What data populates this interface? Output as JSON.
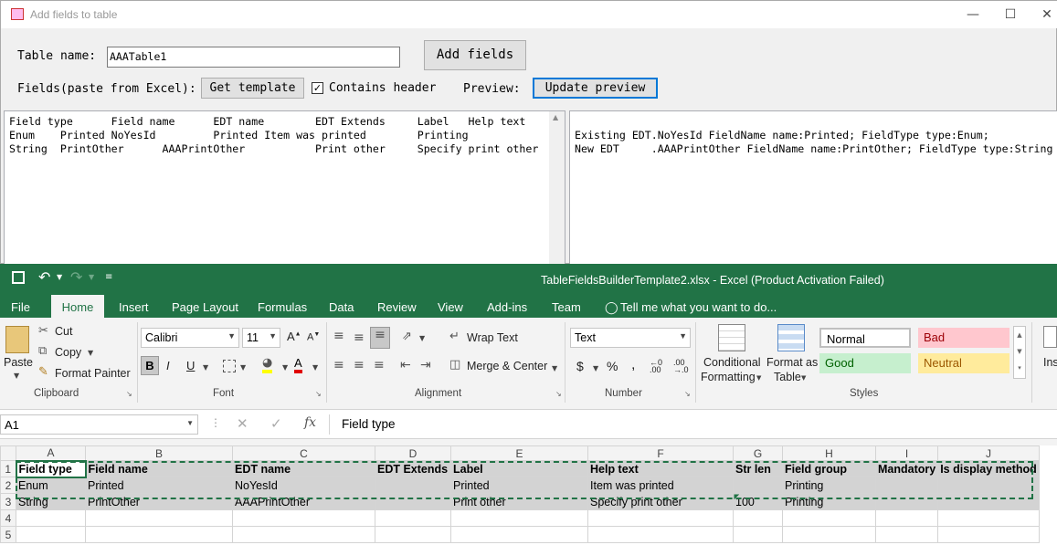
{
  "dialog": {
    "title": "Add fields to table",
    "table_name_label": "Table name:",
    "table_name_value": "AAATable1",
    "add_fields_label": "Add fields",
    "fields_label": "Fields(paste from Excel):",
    "get_template_label": "Get template",
    "contains_header_label": "Contains header",
    "contains_header_checked": true,
    "preview_label": "Preview:",
    "update_preview_label": "Update preview",
    "input_text": "Field type      Field name      EDT name        EDT Extends     Label   Help text\nEnum    Printed NoYesId         Printed Item was printed        Printing\nString  PrintOther      AAAPrintOther           Print other     Specify print other",
    "preview_text": "\nExisting EDT.NoYesId FieldName name:Printed; FieldType type:Enum;\nNew EDT     .AAAPrintOther FieldName name:PrintOther; FieldType type:String"
  },
  "excel": {
    "window_title": "TableFieldsBuilderTemplate2.xlsx - Excel (Product Activation Failed)",
    "tabs": [
      "File",
      "Home",
      "Insert",
      "Page Layout",
      "Formulas",
      "Data",
      "Review",
      "View",
      "Add-ins",
      "Team"
    ],
    "tell_me": "Tell me what you want to do...",
    "clipboard": {
      "paste": "Paste",
      "cut": "Cut",
      "copy": "Copy",
      "format_painter": "Format Painter",
      "group": "Clipboard"
    },
    "font": {
      "name": "Calibri",
      "size": "11",
      "group": "Font"
    },
    "alignment": {
      "wrap_text": "Wrap Text",
      "merge_center": "Merge & Center",
      "group": "Alignment"
    },
    "number": {
      "format": "Text",
      "group": "Number"
    },
    "styles": {
      "conditional": "Conditional",
      "formatting": "Formatting",
      "format_as": "Format as",
      "table": "Table",
      "normal": "Normal",
      "bad": "Bad",
      "good": "Good",
      "neutral": "Neutral",
      "group": "Styles"
    },
    "insert_partial": "Ins",
    "name_box": "A1",
    "formula": "Field type",
    "columns": [
      "A",
      "B",
      "C",
      "D",
      "E",
      "F",
      "G",
      "H",
      "I",
      "J"
    ],
    "rows": [
      [
        "Field type",
        "Field name",
        "EDT name",
        "EDT Extends",
        "Label",
        "Help text",
        "Str len",
        "Field group",
        "Mandatory",
        "Is display method"
      ],
      [
        "Enum",
        "Printed",
        "NoYesId",
        "",
        "Printed",
        "Item was printed",
        "",
        "Printing",
        "",
        ""
      ],
      [
        "String",
        "PrintOther",
        "AAAPrintOther",
        "",
        "Print other",
        "Specify print other",
        "100",
        "Printing",
        "",
        ""
      ],
      [
        "",
        "",
        "",
        "",
        "",
        "",
        "",
        "",
        "",
        ""
      ],
      [
        "",
        "",
        "",
        "",
        "",
        "",
        "",
        "",
        "",
        ""
      ]
    ],
    "row_numbers": [
      "1",
      "2",
      "3",
      "4",
      "5"
    ]
  }
}
